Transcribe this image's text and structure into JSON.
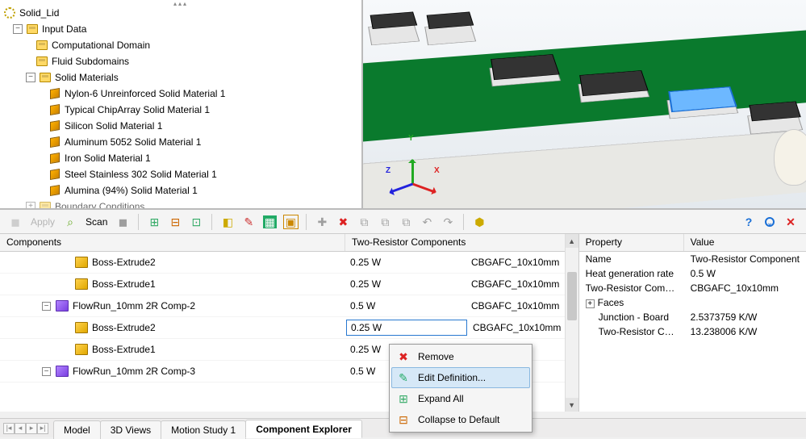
{
  "tree": {
    "root": "Solid_Lid",
    "input_data": "Input Data",
    "computational_domain": "Computational Domain",
    "fluid_subdomains": "Fluid Subdomains",
    "solid_materials": "Solid Materials",
    "mat1": "Nylon-6 Unreinforced Solid Material 1",
    "mat2": "Typical ChipArray Solid Material 1",
    "mat3": "Silicon Solid Material 1",
    "mat4": "Aluminum 5052 Solid Material 1",
    "mat5": "Iron Solid Material 1",
    "mat6": "Steel Stainless 302 Solid Material 1",
    "mat7": "Alumina (94%) Solid Material 1",
    "boundary": "Boundary Conditions"
  },
  "triad": {
    "x": "X",
    "y": "Y",
    "z": "Z"
  },
  "toolbar": {
    "apply": "Apply",
    "scan": "Scan"
  },
  "grid": {
    "col_components": "Components",
    "col_two_resistor": "Two-Resistor Components",
    "rows": [
      {
        "indent": 2,
        "toggle": "",
        "icon": "box",
        "name": "Boss-Extrude2",
        "power": "0.25 W",
        "comp": "CBGAFC_10x10mm"
      },
      {
        "indent": 2,
        "toggle": "",
        "icon": "box",
        "name": "Boss-Extrude1",
        "power": "0.25 W",
        "comp": "CBGAFC_10x10mm"
      },
      {
        "indent": 1,
        "toggle": "−",
        "icon": "flow",
        "name": "FlowRun_10mm 2R Comp-2",
        "power": "0.5 W",
        "comp": "CBGAFC_10x10mm"
      },
      {
        "indent": 2,
        "toggle": "",
        "icon": "box",
        "name": "Boss-Extrude2",
        "power": "0.25 W",
        "comp": "CBGAFC_10x10mm",
        "editing": true
      },
      {
        "indent": 2,
        "toggle": "",
        "icon": "box",
        "name": "Boss-Extrude1",
        "power": "0.25 W",
        "comp": ""
      },
      {
        "indent": 1,
        "toggle": "−",
        "icon": "flow",
        "name": "FlowRun_10mm 2R Comp-3",
        "power": "0.5 W",
        "comp": ""
      }
    ]
  },
  "props": {
    "col_property": "Property",
    "col_value": "Value",
    "rows": [
      {
        "k": "Name",
        "v": "Two-Resistor Component"
      },
      {
        "k": "Heat generation rate",
        "v": "0.5 W"
      },
      {
        "k": "Two-Resistor Component",
        "v": "CBGAFC_10x10mm"
      },
      {
        "k": "Faces",
        "v": "",
        "expander": "+"
      },
      {
        "k": "Junction - Board",
        "v": "2.5373759 K/W",
        "indent": true
      },
      {
        "k": "Two-Resistor Compone",
        "v": "13.238006 K/W",
        "indent": true
      }
    ]
  },
  "context_menu": {
    "remove": "Remove",
    "edit": "Edit Definition...",
    "expand": "Expand All",
    "collapse": "Collapse to Default"
  },
  "tabs": {
    "model": "Model",
    "views3d": "3D Views",
    "motion": "Motion Study 1",
    "explorer": "Component Explorer"
  },
  "icons": {
    "help": "?",
    "collapse": "⌄",
    "close": "✕",
    "plus": "✚",
    "x": "✖",
    "undo": "↶",
    "redo": "↷"
  }
}
